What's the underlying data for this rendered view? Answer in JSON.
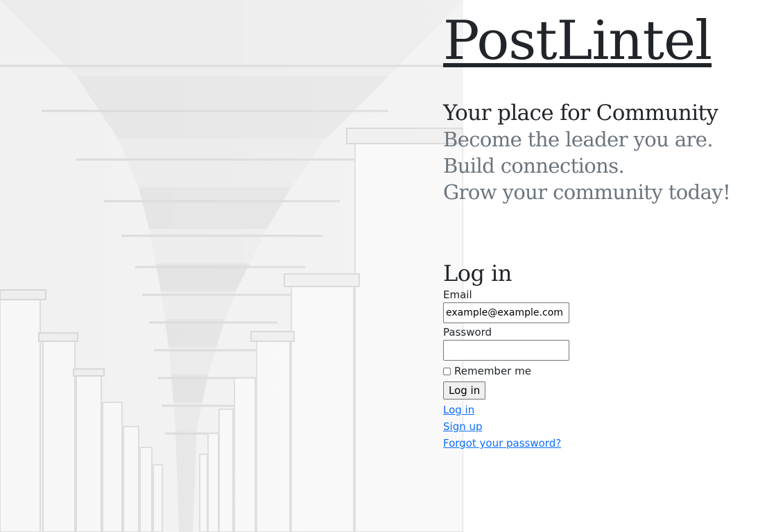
{
  "brand": {
    "name": "PostLintel"
  },
  "hero": {
    "tagline": "Your place for Community",
    "lines": [
      "Become the leader you are.",
      "Build connections.",
      "Grow your community today!"
    ]
  },
  "login_form": {
    "heading": "Log in",
    "email_label": "Email",
    "email_value": "example@example.com",
    "password_label": "Password",
    "password_value": "",
    "remember_label": "Remember me",
    "remember_checked": false,
    "submit_label": "Log in"
  },
  "links": {
    "login": "Log in",
    "signup": "Sign up",
    "forgot": "Forgot your password?"
  },
  "colors": {
    "text": "#212529",
    "muted": "#6c757d",
    "link": "#0d6efd"
  },
  "background": {
    "icon": "colonnade-photo"
  }
}
